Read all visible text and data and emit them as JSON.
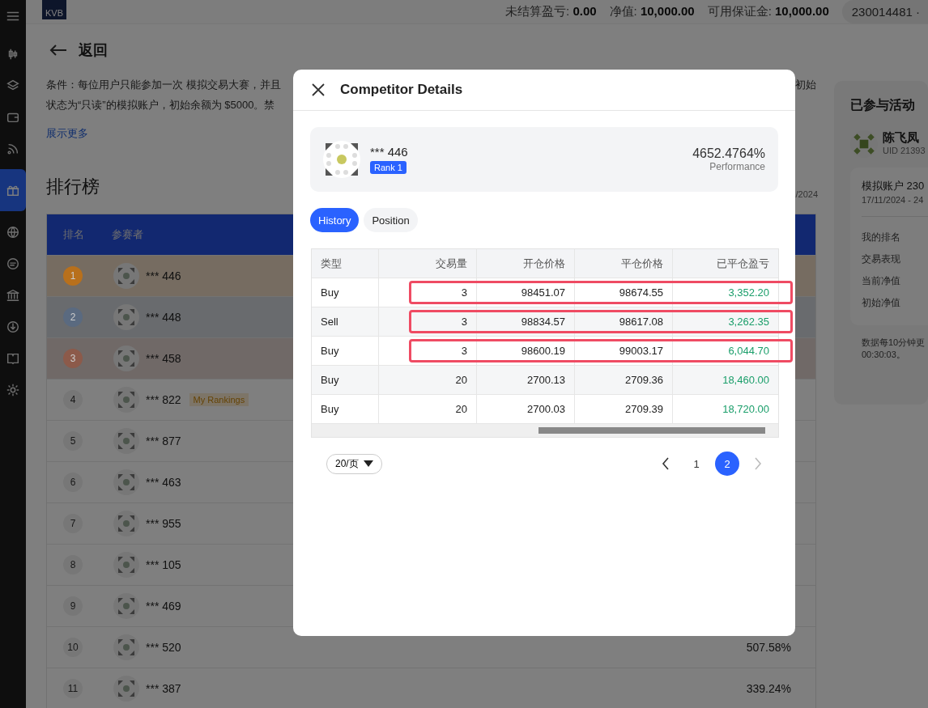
{
  "sidebar": {
    "items": [
      {
        "selected": false
      },
      {
        "selected": false
      },
      {
        "selected": false
      },
      {
        "selected": false
      },
      {
        "selected": false
      },
      {
        "selected": true
      },
      {
        "selected": false
      },
      {
        "selected": false
      },
      {
        "selected": false
      },
      {
        "selected": false
      },
      {
        "selected": false
      },
      {
        "selected": false
      }
    ]
  },
  "top_bar": {
    "logo": "KVB",
    "stats": [
      {
        "label": "未结算盈亏:",
        "value": "0.00"
      },
      {
        "label": "净值:",
        "value": "10,000.00"
      },
      {
        "label": "可用保证金:",
        "value": "10,000.00"
      }
    ],
    "account": "230014481 ·"
  },
  "back": {
    "label": "返回"
  },
  "conditions": {
    "lines_left": [
      "条件：每位用户只能参加一次 模拟交易大赛，并且",
      "状态为“只读”的模拟账户，初始余额为 $5000。禁"
    ],
    "line_right": "初始",
    "show_more": "展示更多"
  },
  "leaderboard": {
    "title": "排行榜",
    "date": "/2024",
    "columns": [
      "排名",
      "参赛者"
    ],
    "rows": [
      {
        "rank": "1",
        "name": "*** 446",
        "color": "#b8701c"
      },
      {
        "rank": "2",
        "name": "*** 448",
        "color": "#5a6a80"
      },
      {
        "rank": "3",
        "name": "*** 458",
        "color": "#8c5a4a"
      },
      {
        "rank": "4",
        "name": "*** 822",
        "badge": "My Rankings"
      },
      {
        "rank": "5",
        "name": "*** 877"
      },
      {
        "rank": "6",
        "name": "*** 463"
      },
      {
        "rank": "7",
        "name": "*** 955"
      },
      {
        "rank": "8",
        "name": "*** 105"
      },
      {
        "rank": "9",
        "name": "*** 469"
      },
      {
        "rank": "10",
        "name": "*** 520",
        "performance": "507.58%"
      },
      {
        "rank": "11",
        "name": "*** 387",
        "performance": "339.24%"
      }
    ]
  },
  "side_panel": {
    "title": "已参与活动",
    "user": "陈飞凤",
    "uid": "UID 21393",
    "account": "模拟账户 230",
    "dates": "17/11/2024 - 24",
    "labels": [
      "我的排名",
      "交易表现",
      "当前净值",
      "初始净值"
    ],
    "note": [
      "数据每10分钟更",
      "00:30:03。"
    ]
  },
  "modal": {
    "title": "Competitor Details",
    "competitor": {
      "name": "*** 446",
      "rank": "Rank 1",
      "performance": "4652.4764%",
      "performance_label": "Performance"
    },
    "tabs": [
      {
        "label": "History",
        "selected": true
      },
      {
        "label": "Position",
        "selected": false
      }
    ],
    "columns": [
      "类型",
      "交易量",
      "开仓价格",
      "平仓价格",
      "已平仓盈亏"
    ],
    "trades": [
      {
        "type": "Buy",
        "volume": "3",
        "open": "98451.07",
        "close": "98674.55",
        "pnl": "3,352.20",
        "highlighted": true
      },
      {
        "type": "Sell",
        "volume": "3",
        "open": "98834.57",
        "close": "98617.08",
        "pnl": "3,262.35",
        "highlighted": true
      },
      {
        "type": "Buy",
        "volume": "3",
        "open": "98600.19",
        "close": "99003.17",
        "pnl": "6,044.70",
        "highlighted": true
      },
      {
        "type": "Buy",
        "volume": "20",
        "open": "2700.13",
        "close": "2709.36",
        "pnl": "18,460.00",
        "highlighted": false
      },
      {
        "type": "Buy",
        "volume": "20",
        "open": "2700.03",
        "close": "2709.39",
        "pnl": "18,720.00",
        "highlighted": false
      }
    ],
    "page_size": "20/页",
    "pages": [
      {
        "label": "1",
        "selected": false
      },
      {
        "label": "2",
        "selected": true
      }
    ],
    "next_disabled": true
  }
}
